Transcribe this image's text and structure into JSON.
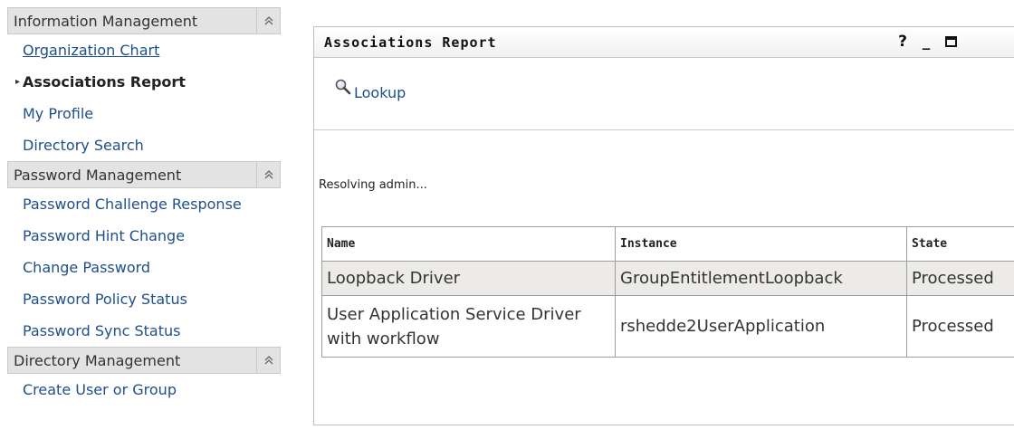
{
  "sidebar": {
    "sections": [
      {
        "title": "Information Management",
        "items": [
          {
            "label": "Organization Chart"
          },
          {
            "label": "Associations Report"
          },
          {
            "label": "My Profile"
          },
          {
            "label": "Directory Search"
          }
        ]
      },
      {
        "title": "Password Management",
        "items": [
          {
            "label": "Password Challenge Response"
          },
          {
            "label": "Password Hint Change"
          },
          {
            "label": "Change Password"
          },
          {
            "label": "Password Policy Status"
          },
          {
            "label": "Password Sync Status"
          }
        ]
      },
      {
        "title": "Directory Management",
        "items": [
          {
            "label": "Create User or Group"
          }
        ]
      }
    ]
  },
  "portlet": {
    "title": "Associations Report",
    "controls": {
      "help": "?",
      "minimize": "_"
    },
    "lookup_label": "Lookup",
    "status_text": "Resolving admin...",
    "table": {
      "headers": [
        "Name",
        "Instance",
        "State"
      ],
      "rows": [
        {
          "name": "Loopback Driver",
          "instance": "GroupEntitlementLoopback",
          "state": "Processed"
        },
        {
          "name": "User Application Service Driver with workflow",
          "instance": "rshedde2UserApplication",
          "state": "Processed"
        }
      ]
    }
  },
  "icons": {
    "collapse": "double-chevron-up-icon",
    "lookup": "magnifier-icon",
    "maximize": "maximize-icon"
  },
  "colors": {
    "link": "#1f4f8a",
    "section_header_bg": "#e3e3e3",
    "shaded_row_bg": "#ecebe8"
  }
}
